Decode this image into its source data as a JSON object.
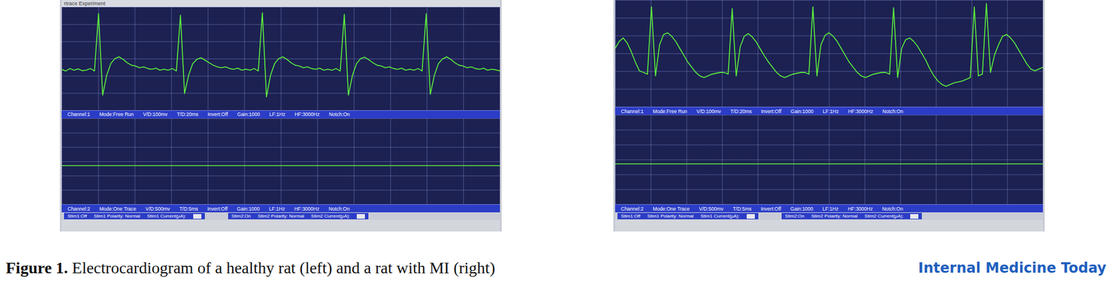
{
  "figure": {
    "panels": [
      {
        "title": "rtrace Experiment",
        "channel1": {
          "info": [
            "Channel:1",
            "Mode:Free Run",
            "V/D:100mv",
            "T/D:20ms",
            "Invert:Off",
            "Gain:1000",
            "LF:1Hz",
            "HF:3000Hz",
            "Notch:On"
          ],
          "trace": [
            5,
            -5,
            10,
            0,
            8,
            -3,
            0,
            10,
            -5,
            340,
            -150,
            -30,
            40,
            70,
            80,
            65,
            45,
            30,
            25,
            15,
            20,
            10,
            5,
            12,
            0,
            6,
            0,
            10,
            -5,
            330,
            -140,
            -30,
            40,
            65,
            75,
            60,
            45,
            30,
            20,
            15,
            20,
            10,
            5,
            12,
            0,
            6,
            0,
            10,
            -5,
            345,
            -160,
            -30,
            40,
            70,
            80,
            65,
            45,
            30,
            25,
            15,
            20,
            10,
            5,
            12,
            0,
            6,
            0,
            10,
            -5,
            335,
            -150,
            -30,
            40,
            70,
            78,
            62,
            45,
            30,
            25,
            15,
            20,
            10,
            5,
            12,
            0,
            6,
            0,
            10,
            -5,
            340,
            -145,
            -30,
            40,
            68,
            80,
            65,
            45,
            30,
            25,
            15,
            20,
            10,
            5,
            12,
            0,
            6,
            2,
            -4
          ]
        },
        "channel2": {
          "info": [
            "Channel:2",
            "Mode:One Trace",
            "V/D:500mv",
            "T/D:5ms",
            "Invert:Off",
            "Gain:1000",
            "LF:1Hz",
            "HF:3000Hz",
            "Notch:On"
          ],
          "trace": [
            0,
            0
          ]
        },
        "stim": [
          [
            "Stim1:Off",
            "Stim1 Polarity: Normal",
            "Stim1 Current(µA):"
          ],
          [
            "Stim2:On",
            "Stim2 Polarity: Normal",
            "Stim2 Current(µA):"
          ]
        ]
      },
      {
        "title": "",
        "channel1": {
          "info": [
            "Channel:1",
            "Mode:Free Run",
            "V/D:100mv",
            "T/D:20ms",
            "Invert:Off",
            "Gain:1000",
            "LF:1Hz",
            "HF:3000Hz",
            "Notch:On"
          ],
          "trace": [
            100,
            140,
            160,
            130,
            80,
            20,
            -30,
            -40,
            -50,
            340,
            -60,
            120,
            180,
            190,
            170,
            140,
            100,
            60,
            20,
            -10,
            -40,
            -60,
            -70,
            -60,
            -50,
            -45,
            -40,
            -40,
            -50,
            330,
            -60,
            110,
            170,
            185,
            165,
            135,
            95,
            55,
            20,
            -10,
            -40,
            -60,
            -70,
            -60,
            -50,
            -45,
            -40,
            -40,
            -50,
            340,
            -60,
            120,
            175,
            190,
            170,
            140,
            100,
            60,
            20,
            -10,
            -40,
            -60,
            -70,
            -60,
            -50,
            -45,
            -40,
            -40,
            -50,
            335,
            -70,
            100,
            150,
            160,
            140,
            110,
            70,
            30,
            -20,
            -60,
            -90,
            -110,
            -120,
            -110,
            -100,
            -95,
            -90,
            -80,
            -70,
            340,
            -60,
            -50,
            360,
            -40,
            60,
            120,
            170,
            180,
            160,
            130,
            90,
            50,
            10,
            -20,
            -30,
            -20,
            -10
          ]
        },
        "channel2": {
          "info": [
            "Channel:2",
            "Mode:One Trace",
            "V/D:500mv",
            "T/D:5ms",
            "Invert:Off",
            "Gain:1000",
            "LF:1Hz",
            "HF:3000Hz",
            "Notch:On"
          ],
          "trace": [
            0,
            0
          ]
        },
        "stim": [
          [
            "Stim1:Off",
            "Stim1 Polarity: Normal",
            "Stim1 Current(µA):"
          ],
          [
            "Stim2:On",
            "Stim2 Polarity: Normal",
            "Stim2 Current(µA):"
          ]
        ]
      }
    ],
    "caption": {
      "label": "Figure 1.",
      "text": "Electrocardiogram of a healthy rat (left) and a rat with MI (right)"
    },
    "journal": "Internal Medicine Today"
  }
}
